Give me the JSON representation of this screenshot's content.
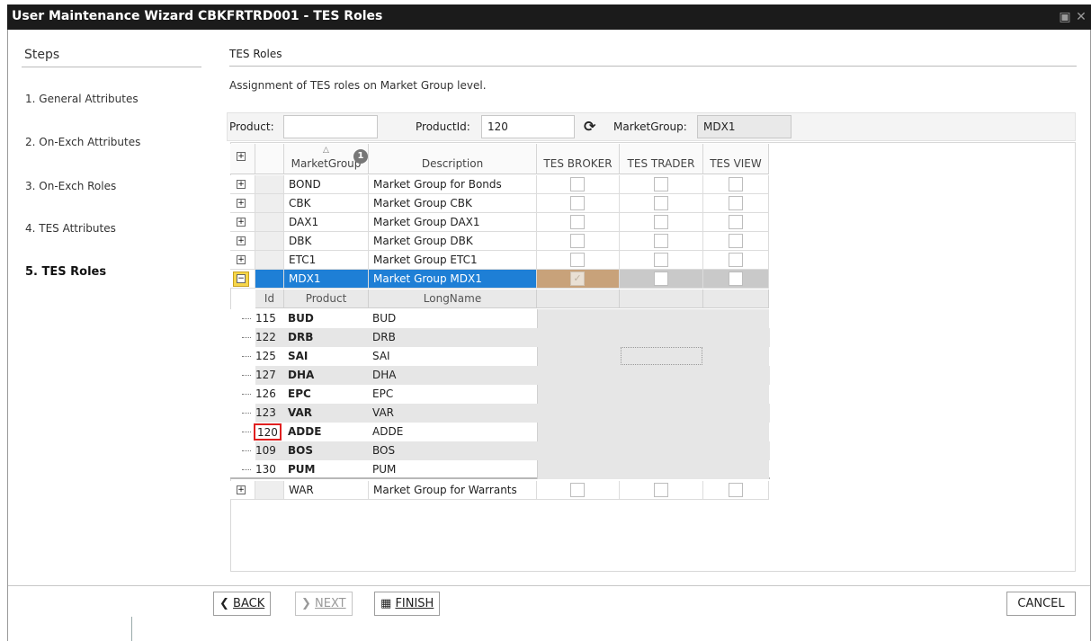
{
  "window": {
    "title": "User Maintenance Wizard CBKFRTRD001 - TES Roles",
    "icons": [
      "window-icon",
      "close-icon"
    ]
  },
  "steps": {
    "heading": "Steps",
    "items": [
      {
        "label": "1. General Attributes"
      },
      {
        "label": "2. On-Exch Attributes"
      },
      {
        "label": "3. On-Exch Roles"
      },
      {
        "label": "4. TES Attributes"
      },
      {
        "label": "5. TES Roles",
        "active": true
      }
    ]
  },
  "section": {
    "title": "TES Roles",
    "description": "Assignment of TES roles on Market Group level."
  },
  "filters": {
    "product_label": "Product:",
    "product_value": "",
    "productid_label": "ProductId:",
    "productid_value": "120",
    "marketgroup_label": "MarketGroup:",
    "marketgroup_value": "MDX1",
    "refresh_icon": "refresh-icon"
  },
  "grid": {
    "columns": {
      "marketgroup": "MarketGroup",
      "description": "Description",
      "tes_broker": "TES BROKER",
      "tes_trader": "TES TRADER",
      "tes_view": "TES VIEW"
    },
    "sort_badge": "1",
    "rows": [
      {
        "market_group": "BOND",
        "description": "Market Group for Bonds",
        "tes_broker": false,
        "tes_trader": false,
        "tes_view": false
      },
      {
        "market_group": "CBK",
        "description": "Market Group CBK",
        "tes_broker": false,
        "tes_trader": false,
        "tes_view": false
      },
      {
        "market_group": "DAX1",
        "description": "Market Group DAX1",
        "tes_broker": false,
        "tes_trader": false,
        "tes_view": false
      },
      {
        "market_group": "DBK",
        "description": "Market Group DBK",
        "tes_broker": false,
        "tes_trader": false,
        "tes_view": false
      },
      {
        "market_group": "ETC1",
        "description": "Market Group ETC1",
        "tes_broker": false,
        "tes_trader": false,
        "tes_view": false
      },
      {
        "market_group": "MDX1",
        "description": "Market Group MDX1",
        "tes_broker": true,
        "tes_trader": false,
        "tes_view": false,
        "selected": true,
        "expanded": true
      },
      {
        "market_group": "WAR",
        "description": "Market Group for Warrants",
        "tes_broker": false,
        "tes_trader": false,
        "tes_view": false
      }
    ],
    "subgrid": {
      "columns": {
        "id": "Id",
        "product": "Product",
        "longname": "LongName"
      },
      "rows": [
        {
          "id": "115",
          "product": "BUD",
          "longname": "BUD"
        },
        {
          "id": "122",
          "product": "DRB",
          "longname": "DRB"
        },
        {
          "id": "125",
          "product": "SAI",
          "longname": "SAI"
        },
        {
          "id": "127",
          "product": "DHA",
          "longname": "DHA"
        },
        {
          "id": "126",
          "product": "EPC",
          "longname": "EPC"
        },
        {
          "id": "123",
          "product": "VAR",
          "longname": "VAR"
        },
        {
          "id": "120",
          "product": "ADDE",
          "longname": "ADDE",
          "highlighted": true
        },
        {
          "id": "109",
          "product": "BOS",
          "longname": "BOS"
        },
        {
          "id": "130",
          "product": "PUM",
          "longname": "PUM"
        }
      ]
    }
  },
  "footer": {
    "back": "BACK",
    "next": "NEXT",
    "finish": "FINISH",
    "cancel": "CANCEL"
  },
  "colors": {
    "selection_blue": "#1e7fd6",
    "broker_checked_brown": "#c8a27a",
    "highlight_red": "#e02020"
  }
}
